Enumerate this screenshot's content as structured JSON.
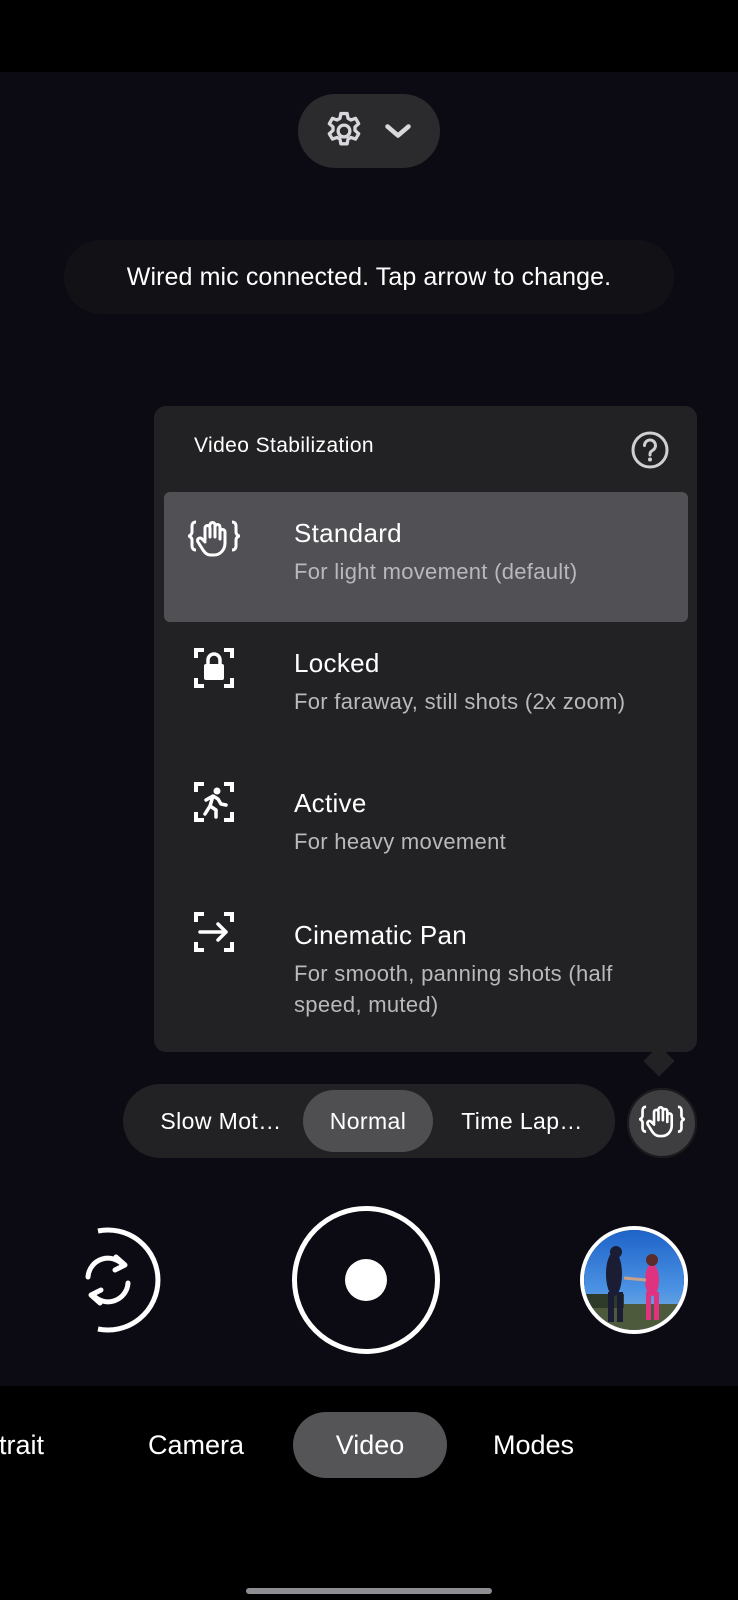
{
  "top_controls": {
    "settings_icon": "gear-icon",
    "dropdown_icon": "chevron-down-icon"
  },
  "toast": {
    "message": "Wired mic connected. Tap arrow to change."
  },
  "stabilization_panel": {
    "title": "Video Stabilization",
    "help_icon": "help-circle-icon",
    "options": [
      {
        "label": "Standard",
        "description": "For light movement (default)",
        "icon": "hand-stabilization-icon",
        "selected": true
      },
      {
        "label": "Locked",
        "description": "For faraway, still shots (2x zoom)",
        "icon": "lock-frame-icon",
        "selected": false
      },
      {
        "label": "Active",
        "description": "For heavy movement",
        "icon": "running-person-icon",
        "selected": false
      },
      {
        "label": "Cinematic Pan",
        "description": "For smooth, panning shots (half speed, muted)",
        "icon": "pan-arrow-icon",
        "selected": false
      }
    ]
  },
  "speed_selector": {
    "items": [
      "Slow Mot…",
      "Normal",
      "Time Lap…"
    ],
    "selected": "Normal"
  },
  "stabilization_toggle": {
    "icon": "hand-stabilization-icon"
  },
  "controls": {
    "flip_icon": "camera-flip-icon",
    "shutter": "record-button",
    "thumbnail": "gallery-thumbnail"
  },
  "modes": {
    "items": [
      "Portrait",
      "Camera",
      "Video",
      "Modes"
    ],
    "selected": "Video"
  },
  "colors": {
    "background": "#000000",
    "panel": "#222224",
    "selected": "#515155",
    "secondary_text": "#b9b9bd"
  }
}
